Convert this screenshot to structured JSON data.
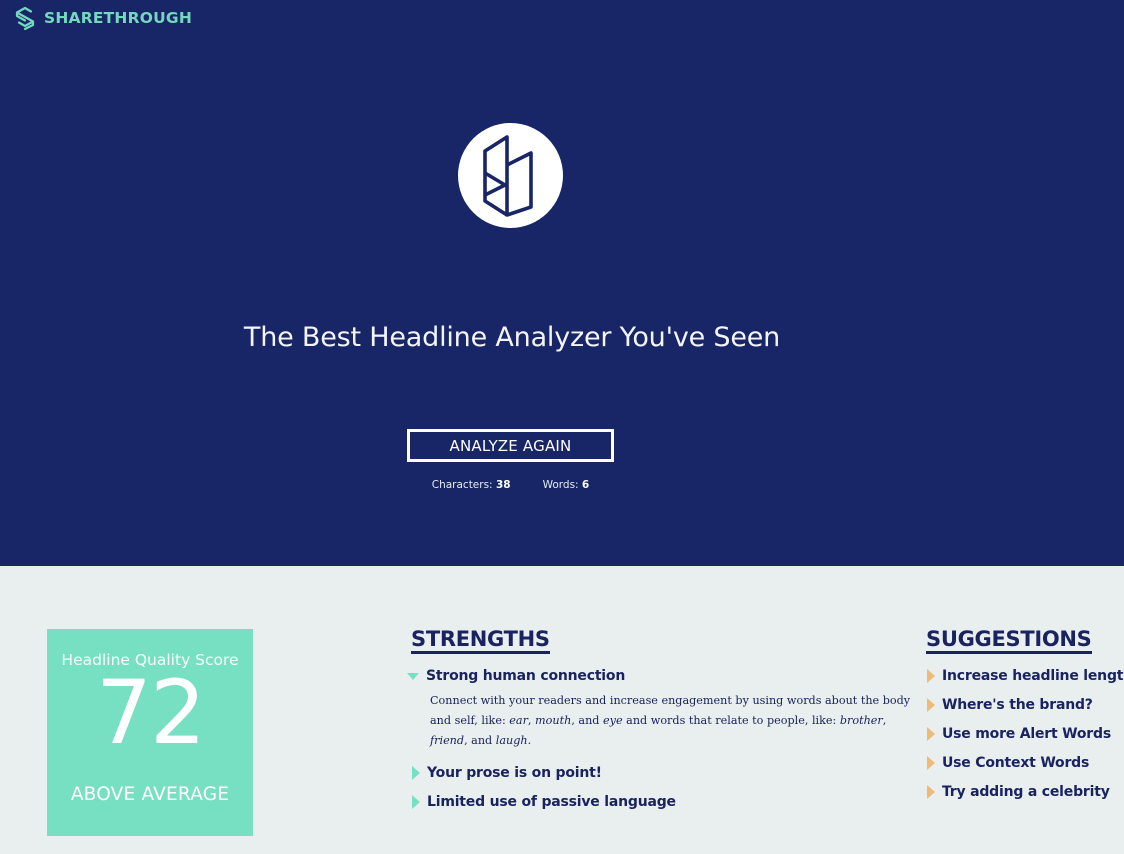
{
  "brand": {
    "name": "SHARETHROUGH",
    "icon": "sharethrough-logo-icon"
  },
  "hero": {
    "logo_icon": "headline-analyzer-logo-icon",
    "headline": "The Best Headline Analyzer You've Seen",
    "analyze_button": "ANALYZE AGAIN",
    "characters_label": "Characters:",
    "characters_value": "38",
    "words_label": "Words:",
    "words_value": "6"
  },
  "score": {
    "label": "Headline Quality Score",
    "value": "72",
    "rating": "ABOVE AVERAGE"
  },
  "strengths": {
    "title": "STRENGTHS",
    "items": [
      {
        "label": "Strong human connection",
        "expanded": true,
        "description": {
          "part1": "Connect with your readers and increase engagement by using words about the body and self, like: ",
          "em1": "ear",
          "sep1": ", ",
          "em2": "mouth",
          "sep2": ", and ",
          "em3": "eye",
          "part2": " and words that relate to people, like: ",
          "em4": "brother",
          "sep3": ", ",
          "em5": "friend",
          "sep4": ", and ",
          "em6": "laugh",
          "end": "."
        }
      },
      {
        "label": "Your prose is on point!",
        "expanded": false
      },
      {
        "label": "Limited use of passive language",
        "expanded": false
      }
    ]
  },
  "suggestions": {
    "title": "SUGGESTIONS",
    "items": [
      {
        "label": "Increase headline length"
      },
      {
        "label": "Where's the brand?"
      },
      {
        "label": "Use more Alert Words"
      },
      {
        "label": "Use Context Words"
      },
      {
        "label": "Try adding a celebrity"
      }
    ]
  },
  "colors": {
    "hero_bg": "#182566",
    "page_bg": "#e9efef",
    "accent_teal": "#77e0c3",
    "accent_orange": "#efba76",
    "navy_text": "#1a2360"
  }
}
